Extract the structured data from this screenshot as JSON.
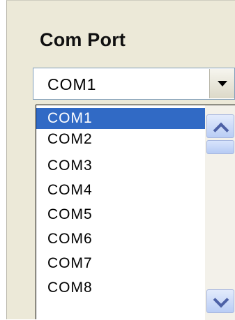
{
  "group": {
    "title": "Com Port"
  },
  "combo": {
    "value": "COM1"
  },
  "dropdown": {
    "items": [
      "COM1",
      "COM2",
      "COM3",
      "COM4",
      "COM5",
      "COM6",
      "COM7",
      "COM8"
    ],
    "selected": "COM1"
  },
  "colors": {
    "selection": "#316ac5",
    "panel": "#ece9d8"
  }
}
